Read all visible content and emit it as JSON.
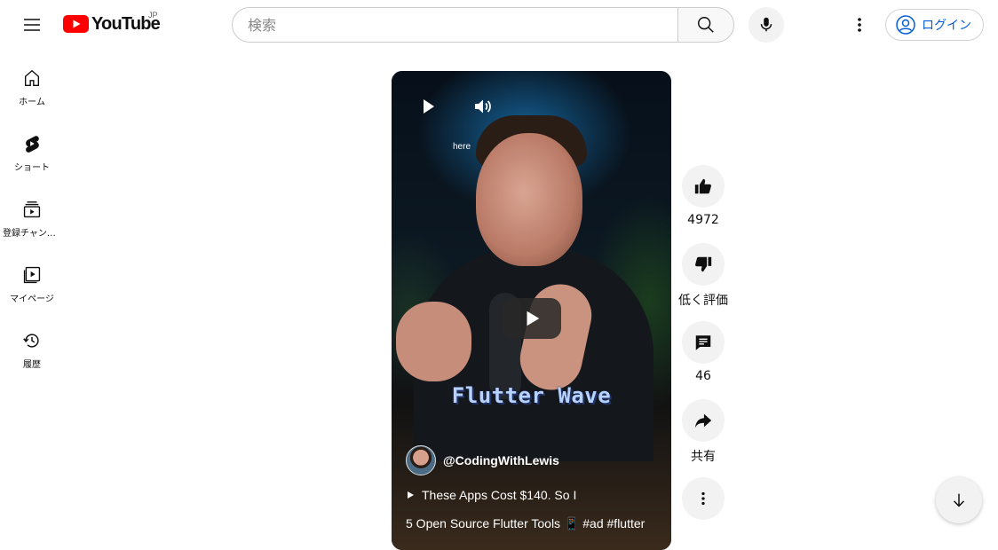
{
  "header": {
    "logo_text": "YouTube",
    "region": "JP",
    "search_placeholder": "検索",
    "login_label": "ログイン"
  },
  "sidebar": {
    "items": [
      {
        "label": "ホーム",
        "icon": "home-icon"
      },
      {
        "label": "ショート",
        "icon": "shorts-icon"
      },
      {
        "label": "登録チャンネル",
        "icon": "subscriptions-icon"
      },
      {
        "label": "マイページ",
        "icon": "library-icon"
      },
      {
        "label": "履歴",
        "icon": "history-icon"
      }
    ]
  },
  "player": {
    "caption": "here",
    "overlay_title": "Flutter Wave",
    "channel": "@CodingWithLewis",
    "music_text": "These Apps Cost $140. So I",
    "description": "5 Open Source Flutter Tools 📱 #ad #flutter"
  },
  "actions": {
    "like_count": "4972",
    "dislike_label": "低く評価",
    "comment_count": "46",
    "share_label": "共有"
  },
  "colors": {
    "brand_red": "#ff0000",
    "link_blue": "#065fd4",
    "button_bg": "#f2f2f2"
  }
}
